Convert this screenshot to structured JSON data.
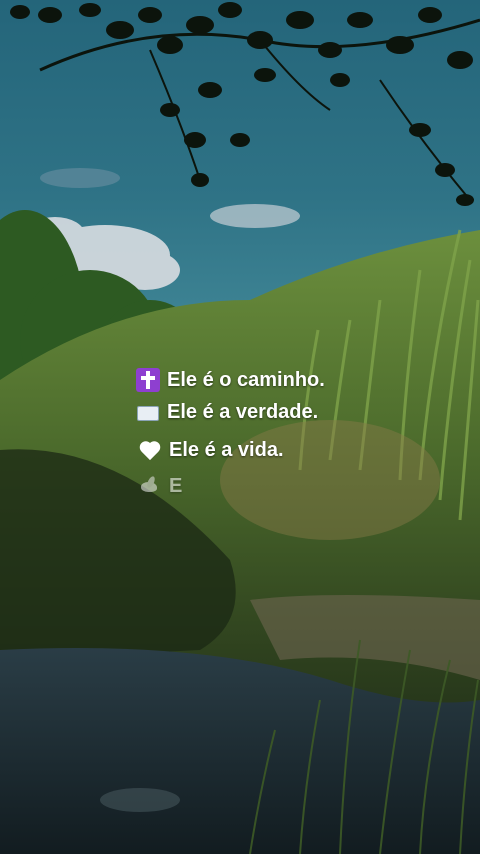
{
  "overlay": {
    "lines": [
      {
        "icon": "cross-icon",
        "text": "Ele é o caminho."
      },
      {
        "icon": "open-book-icon",
        "text": "Ele é a verdade."
      },
      {
        "icon": "white-heart-icon",
        "text": "Ele é a vida."
      },
      {
        "icon": "dove-icon",
        "text": "E"
      }
    ]
  },
  "colors": {
    "sky": "#2e6f85",
    "foliage": "#3f6e2a",
    "water": "#1f2c33"
  }
}
